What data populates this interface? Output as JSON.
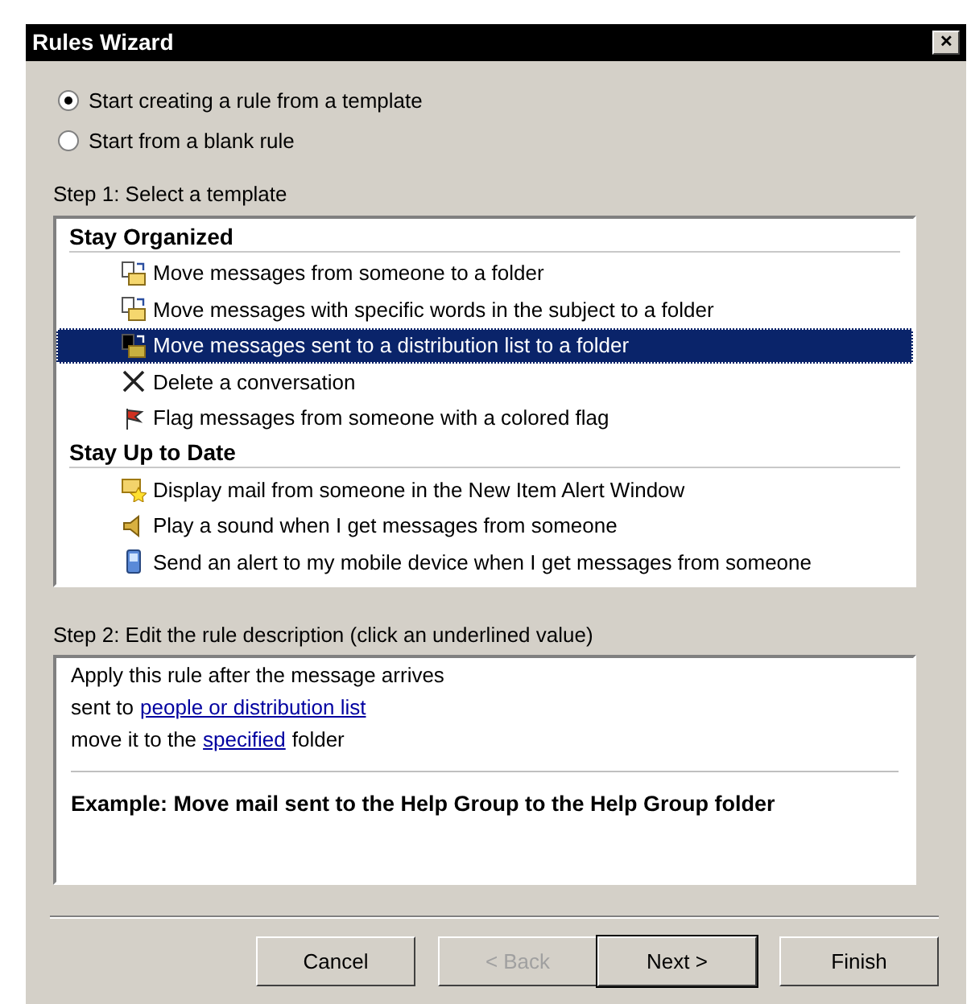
{
  "window": {
    "title": "Rules Wizard",
    "close": "✕"
  },
  "start_options": [
    {
      "label": "Start creating a rule from a template",
      "selected": true
    },
    {
      "label": "Start from a blank rule",
      "selected": false
    }
  ],
  "step1": {
    "label": "Step 1: Select a template",
    "groups": [
      {
        "title": "Stay Organized",
        "items": [
          {
            "label": "Move messages from someone to a folder",
            "kind": "move",
            "selected": false
          },
          {
            "label": "Move messages with specific words in the subject to a folder",
            "kind": "move",
            "selected": false
          },
          {
            "label": "Move messages sent to a distribution list to a folder",
            "kind": "move-list",
            "selected": true
          },
          {
            "label": "Delete a conversation",
            "kind": "delete",
            "selected": false
          },
          {
            "label": "Flag messages from someone with a colored flag",
            "kind": "flag",
            "selected": false
          }
        ]
      },
      {
        "title": "Stay Up to Date",
        "items": [
          {
            "label": "Display mail from someone in the New Item Alert Window",
            "kind": "alert",
            "selected": false
          },
          {
            "label": "Play a sound when I get messages from someone",
            "kind": "sound",
            "selected": false
          },
          {
            "label": "Send an alert to my mobile device when I get messages from someone",
            "kind": "mobile",
            "selected": false
          }
        ]
      }
    ]
  },
  "step2": {
    "label": "Step 2: Edit the rule description (click an underlined value)",
    "lines": [
      [
        {
          "text": "Apply this rule after the message arrives",
          "link": false
        }
      ],
      [
        {
          "text": "sent to",
          "link": false
        },
        {
          "text": "people or distribution list",
          "link": true
        }
      ],
      [
        {
          "text": "move it to the",
          "link": false
        },
        {
          "text": "specified",
          "link": true
        },
        {
          "text": "folder",
          "link": false
        }
      ]
    ],
    "example": "Example: Move mail sent to the Help Group to the Help Group folder"
  },
  "buttons": [
    {
      "label": "Cancel",
      "disabled": false,
      "default": false
    },
    {
      "label": "< Back",
      "disabled": true,
      "default": false
    },
    {
      "label": "Next >",
      "disabled": false,
      "default": true
    },
    {
      "label": "Finish",
      "disabled": false,
      "default": false
    }
  ]
}
